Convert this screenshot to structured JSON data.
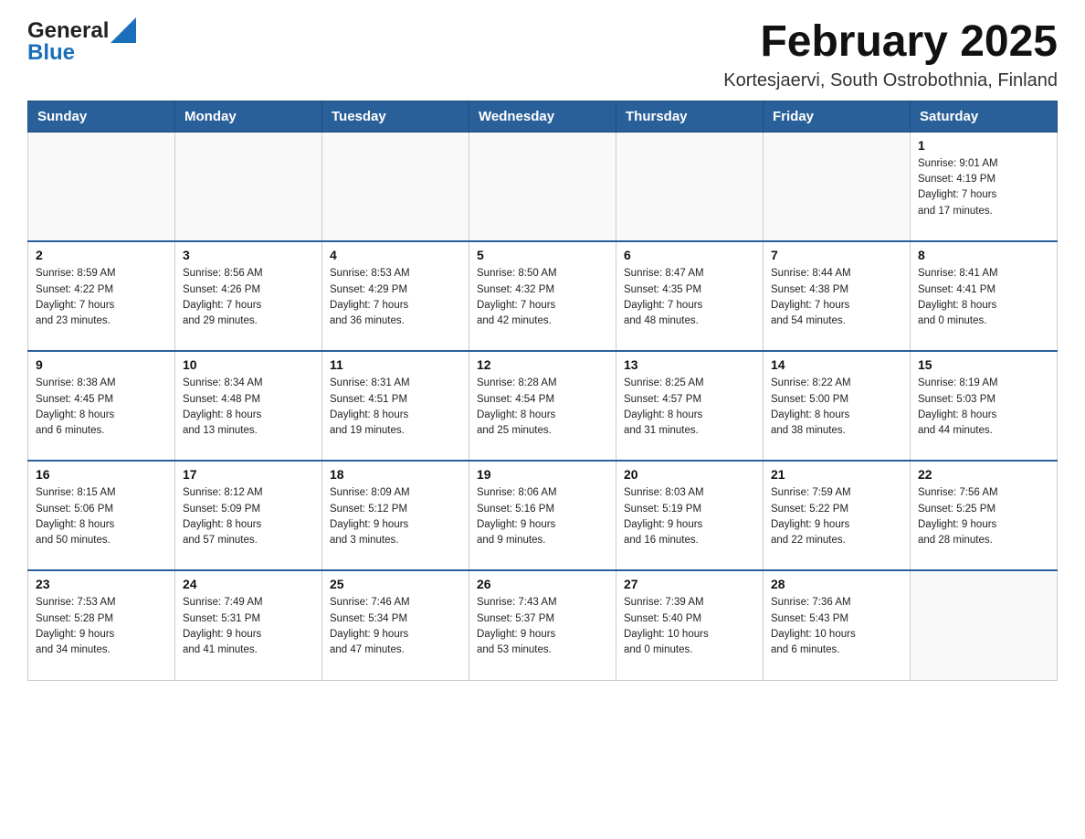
{
  "logo": {
    "general": "General",
    "blue": "Blue",
    "tagline": "Blue"
  },
  "header": {
    "title": "February 2025",
    "subtitle": "Kortesjaervi, South Ostrobothnia, Finland"
  },
  "weekdays": [
    "Sunday",
    "Monday",
    "Tuesday",
    "Wednesday",
    "Thursday",
    "Friday",
    "Saturday"
  ],
  "weeks": [
    [
      {
        "day": "",
        "info": ""
      },
      {
        "day": "",
        "info": ""
      },
      {
        "day": "",
        "info": ""
      },
      {
        "day": "",
        "info": ""
      },
      {
        "day": "",
        "info": ""
      },
      {
        "day": "",
        "info": ""
      },
      {
        "day": "1",
        "info": "Sunrise: 9:01 AM\nSunset: 4:19 PM\nDaylight: 7 hours\nand 17 minutes."
      }
    ],
    [
      {
        "day": "2",
        "info": "Sunrise: 8:59 AM\nSunset: 4:22 PM\nDaylight: 7 hours\nand 23 minutes."
      },
      {
        "day": "3",
        "info": "Sunrise: 8:56 AM\nSunset: 4:26 PM\nDaylight: 7 hours\nand 29 minutes."
      },
      {
        "day": "4",
        "info": "Sunrise: 8:53 AM\nSunset: 4:29 PM\nDaylight: 7 hours\nand 36 minutes."
      },
      {
        "day": "5",
        "info": "Sunrise: 8:50 AM\nSunset: 4:32 PM\nDaylight: 7 hours\nand 42 minutes."
      },
      {
        "day": "6",
        "info": "Sunrise: 8:47 AM\nSunset: 4:35 PM\nDaylight: 7 hours\nand 48 minutes."
      },
      {
        "day": "7",
        "info": "Sunrise: 8:44 AM\nSunset: 4:38 PM\nDaylight: 7 hours\nand 54 minutes."
      },
      {
        "day": "8",
        "info": "Sunrise: 8:41 AM\nSunset: 4:41 PM\nDaylight: 8 hours\nand 0 minutes."
      }
    ],
    [
      {
        "day": "9",
        "info": "Sunrise: 8:38 AM\nSunset: 4:45 PM\nDaylight: 8 hours\nand 6 minutes."
      },
      {
        "day": "10",
        "info": "Sunrise: 8:34 AM\nSunset: 4:48 PM\nDaylight: 8 hours\nand 13 minutes."
      },
      {
        "day": "11",
        "info": "Sunrise: 8:31 AM\nSunset: 4:51 PM\nDaylight: 8 hours\nand 19 minutes."
      },
      {
        "day": "12",
        "info": "Sunrise: 8:28 AM\nSunset: 4:54 PM\nDaylight: 8 hours\nand 25 minutes."
      },
      {
        "day": "13",
        "info": "Sunrise: 8:25 AM\nSunset: 4:57 PM\nDaylight: 8 hours\nand 31 minutes."
      },
      {
        "day": "14",
        "info": "Sunrise: 8:22 AM\nSunset: 5:00 PM\nDaylight: 8 hours\nand 38 minutes."
      },
      {
        "day": "15",
        "info": "Sunrise: 8:19 AM\nSunset: 5:03 PM\nDaylight: 8 hours\nand 44 minutes."
      }
    ],
    [
      {
        "day": "16",
        "info": "Sunrise: 8:15 AM\nSunset: 5:06 PM\nDaylight: 8 hours\nand 50 minutes."
      },
      {
        "day": "17",
        "info": "Sunrise: 8:12 AM\nSunset: 5:09 PM\nDaylight: 8 hours\nand 57 minutes."
      },
      {
        "day": "18",
        "info": "Sunrise: 8:09 AM\nSunset: 5:12 PM\nDaylight: 9 hours\nand 3 minutes."
      },
      {
        "day": "19",
        "info": "Sunrise: 8:06 AM\nSunset: 5:16 PM\nDaylight: 9 hours\nand 9 minutes."
      },
      {
        "day": "20",
        "info": "Sunrise: 8:03 AM\nSunset: 5:19 PM\nDaylight: 9 hours\nand 16 minutes."
      },
      {
        "day": "21",
        "info": "Sunrise: 7:59 AM\nSunset: 5:22 PM\nDaylight: 9 hours\nand 22 minutes."
      },
      {
        "day": "22",
        "info": "Sunrise: 7:56 AM\nSunset: 5:25 PM\nDaylight: 9 hours\nand 28 minutes."
      }
    ],
    [
      {
        "day": "23",
        "info": "Sunrise: 7:53 AM\nSunset: 5:28 PM\nDaylight: 9 hours\nand 34 minutes."
      },
      {
        "day": "24",
        "info": "Sunrise: 7:49 AM\nSunset: 5:31 PM\nDaylight: 9 hours\nand 41 minutes."
      },
      {
        "day": "25",
        "info": "Sunrise: 7:46 AM\nSunset: 5:34 PM\nDaylight: 9 hours\nand 47 minutes."
      },
      {
        "day": "26",
        "info": "Sunrise: 7:43 AM\nSunset: 5:37 PM\nDaylight: 9 hours\nand 53 minutes."
      },
      {
        "day": "27",
        "info": "Sunrise: 7:39 AM\nSunset: 5:40 PM\nDaylight: 10 hours\nand 0 minutes."
      },
      {
        "day": "28",
        "info": "Sunrise: 7:36 AM\nSunset: 5:43 PM\nDaylight: 10 hours\nand 6 minutes."
      },
      {
        "day": "",
        "info": ""
      }
    ]
  ]
}
